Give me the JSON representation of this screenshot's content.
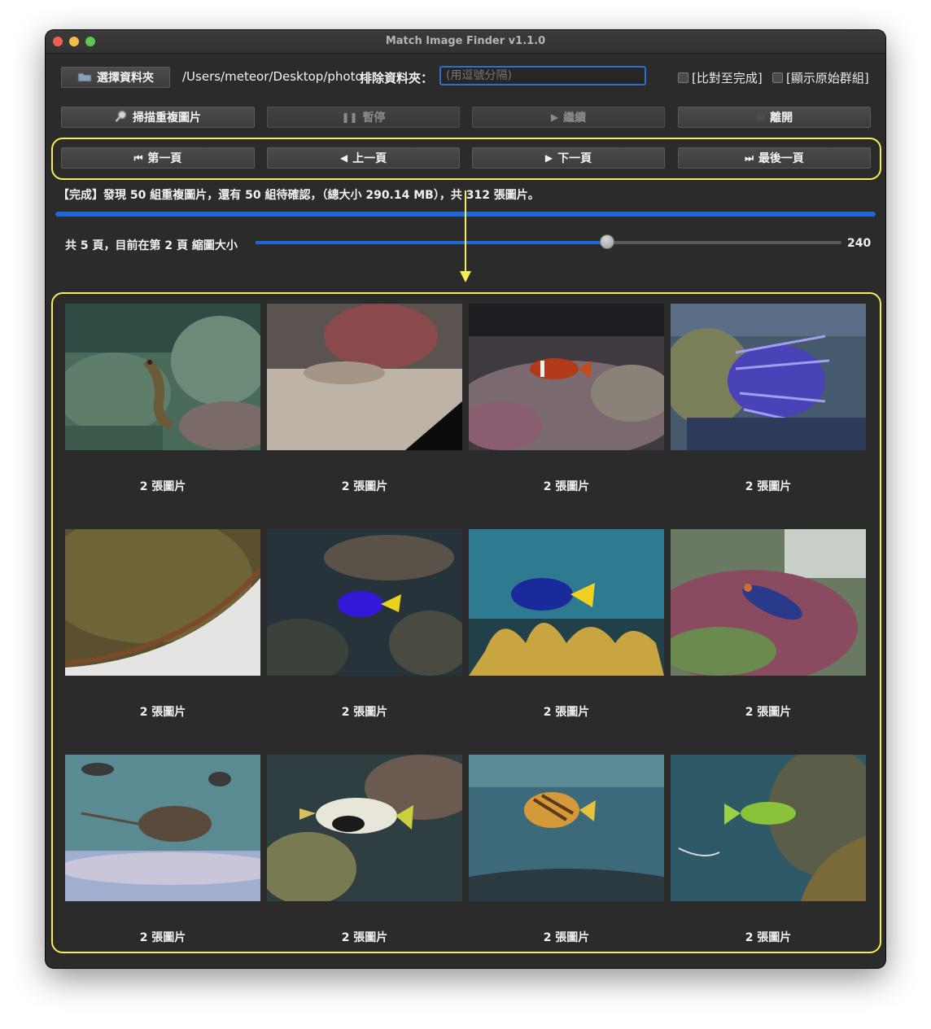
{
  "window": {
    "title": "Match Image Finder v1.1.0"
  },
  "toolbar": {
    "choose_folder": "選擇資料夾",
    "folder_path": "/Users/meteor/Desktop/photo",
    "exclude_label": "排除資料夾：",
    "exclude_placeholder": "(用逗號分隔)",
    "compare_to_end": "[比對至完成]",
    "show_original_groups": "[顯示原始群組]"
  },
  "actions": {
    "scan": "掃描重複圖片",
    "pause": "暫停",
    "resume": "繼續",
    "exit": "離開"
  },
  "pager": {
    "first": "第一頁",
    "prev": "上一頁",
    "next": "下一頁",
    "last": "最後一頁"
  },
  "status": {
    "message": "【完成】發現 50 組重複圖片，還有 50 組待確認，（總大小 290.14 MB），共 312 張圖片。",
    "progress": 1.0
  },
  "pageinfo": {
    "text": "共 5 頁，目前在第 2 頁 縮圖大小",
    "thumb_size_value": "240",
    "slider_fraction": 0.6
  },
  "groups": [
    {
      "caption": "2 張圖片",
      "icon": "moray-eel-photo"
    },
    {
      "caption": "2 張圖片",
      "icon": "goby-fish-photo"
    },
    {
      "caption": "2 張圖片",
      "icon": "clownfish-photo"
    },
    {
      "caption": "2 張圖片",
      "icon": "lionfish-photo"
    },
    {
      "caption": "2 張圖片",
      "icon": "tank-glass-photo"
    },
    {
      "caption": "2 張圖片",
      "icon": "blue-damselfish-photo"
    },
    {
      "caption": "2 張圖片",
      "icon": "blue-tang-photo"
    },
    {
      "caption": "2 張圖片",
      "icon": "mandarinfish-photo"
    },
    {
      "caption": "2 張圖片",
      "icon": "stingray-photo"
    },
    {
      "caption": "2 張圖片",
      "icon": "triggerfish-photo"
    },
    {
      "caption": "2 張圖片",
      "icon": "butterflyfish-photo"
    },
    {
      "caption": "2 張圖片",
      "icon": "wrasse-photo"
    }
  ],
  "colors": {
    "accent": "#1f69d6",
    "highlight": "#f6ee53",
    "background": "#2b2b2b"
  }
}
